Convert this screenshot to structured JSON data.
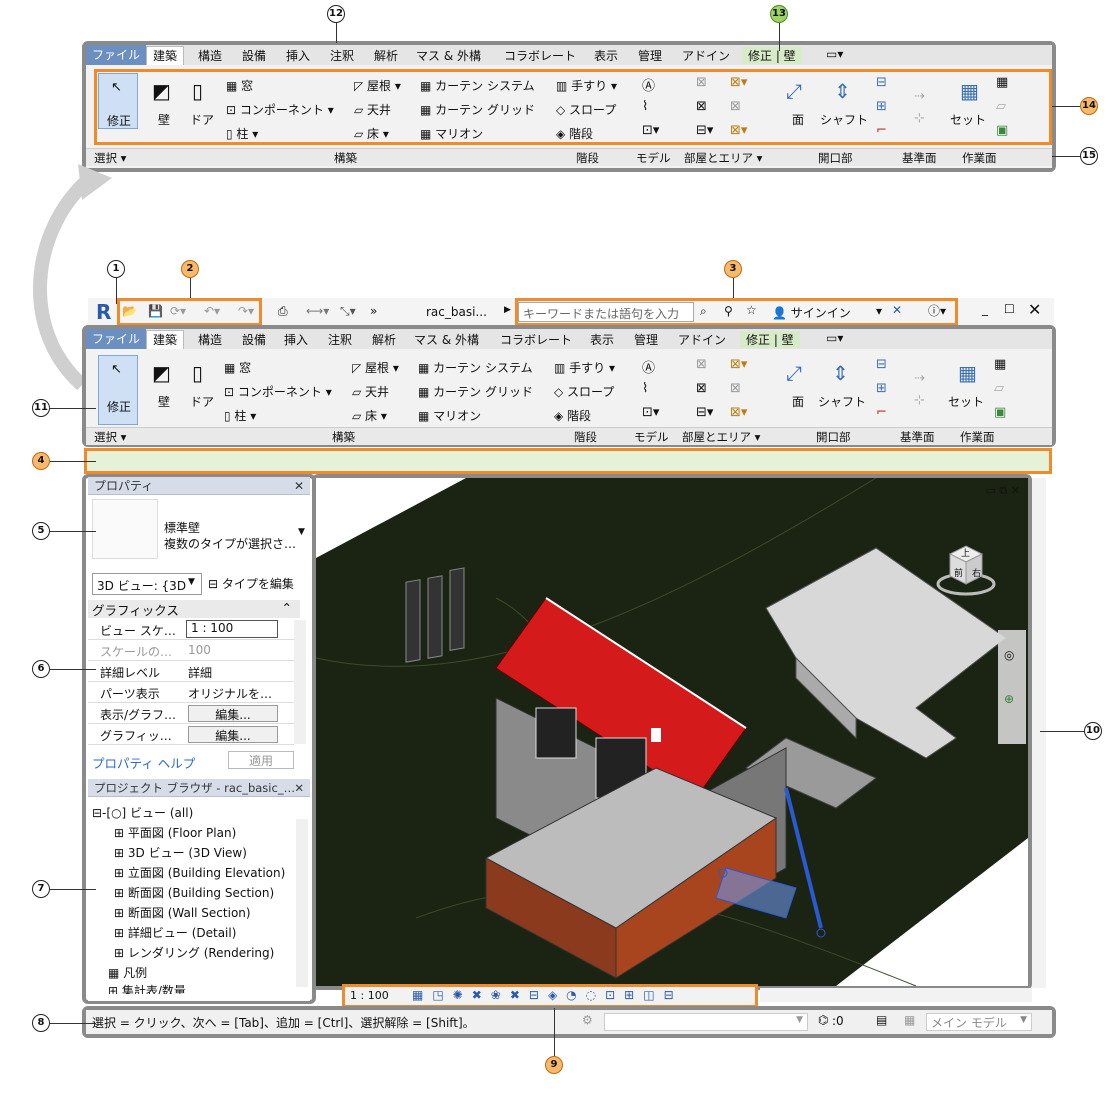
{
  "callouts": [
    "1",
    "2",
    "3",
    "4",
    "5",
    "6",
    "7",
    "8",
    "9",
    "10",
    "11",
    "12",
    "13",
    "14",
    "15"
  ],
  "ribbon": {
    "tabs": [
      "ファイル",
      "建築",
      "構造",
      "設備",
      "挿入",
      "注釈",
      "解析",
      "マス & 外構",
      "コラボレート",
      "表示",
      "管理",
      "アドイン",
      "修正 | 壁"
    ],
    "tools": {
      "modify": "修正",
      "wall": "壁",
      "door": "ドア",
      "window": "窓",
      "component": "コンポーネント",
      "column": "柱",
      "roof": "屋根",
      "ceiling": "天井",
      "floor": "床",
      "curtain_system": "カーテン システム",
      "curtain_grid": "カーテン グリッド",
      "mullion": "マリオン",
      "railing": "手すり",
      "ramp": "スロープ",
      "stair": "階段",
      "face": "面",
      "shaft": "シャフト",
      "set": "セット"
    },
    "panels": [
      "選択",
      "構築",
      "階段",
      "モデル",
      "部屋とエリア",
      "開口部",
      "基準面",
      "作業面"
    ]
  },
  "titlebar": {
    "doc_title": "rac_basi...",
    "search_placeholder": "キーワードまたは語句を入力",
    "signin": "サインイン"
  },
  "properties": {
    "title": "プロパティ",
    "type_line1": "標準壁",
    "type_line2": "複数のタイプが選択さ…",
    "view_selector": "3D ビュー: {3D",
    "edit_type": "タイプを編集",
    "section": "グラフィックス",
    "rows": [
      {
        "label": "ビュー スケ…",
        "value": "1 : 100"
      },
      {
        "label": "スケールの…",
        "value": "100"
      },
      {
        "label": "詳細レベル",
        "value": "詳細"
      },
      {
        "label": "パーツ表示",
        "value": "オリジナルを…"
      },
      {
        "label": "表示/グラフ…",
        "value": "編集..."
      },
      {
        "label": "グラフィッ…",
        "value": "編集..."
      }
    ],
    "help": "プロパティ ヘルプ",
    "apply": "適用"
  },
  "browser": {
    "title": "プロジェクト ブラウザ - rac_basic_…",
    "root": "ビュー (all)",
    "items": [
      "平面図 (Floor Plan)",
      "3D ビュー (3D View)",
      "立面図 (Building Elevation)",
      "断面図 (Building Section)",
      "断面図 (Wall Section)",
      "詳細ビュー (Detail)",
      "レンダリング (Rendering)"
    ],
    "legend": "凡例",
    "schedule": "集計表/数量"
  },
  "viewcube": {
    "top": "上",
    "front": "前",
    "right": "右"
  },
  "viewbar": {
    "scale": "1 : 100"
  },
  "status": {
    "hint": "選択 = クリック、次へ = [Tab]、追加 = [Ctrl]、選択解除 = [Shift]。",
    "count": ":0",
    "model": "メイン モデル"
  }
}
